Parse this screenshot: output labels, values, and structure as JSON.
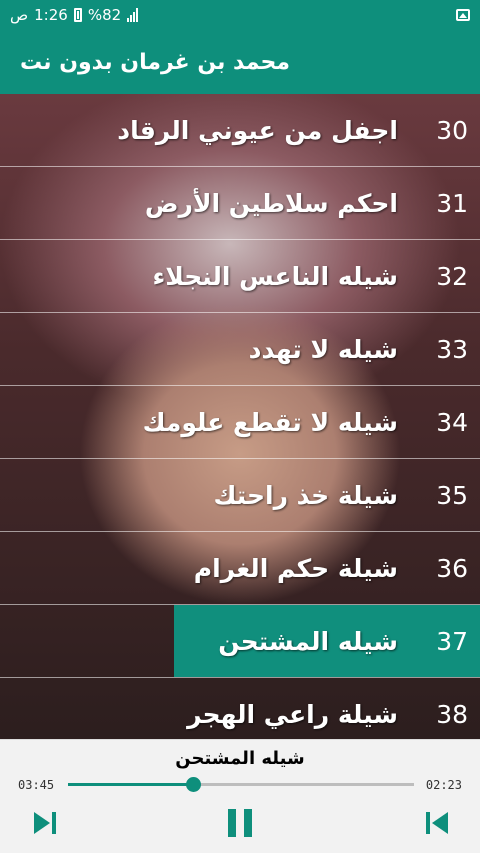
{
  "status": {
    "carrier": "ص",
    "time": "1:26",
    "battery": "%82"
  },
  "appbar": {
    "title": "محمد بن غرمان بدون نت"
  },
  "list": [
    {
      "num": "30",
      "title": "اجفل من عيوني الرقاد"
    },
    {
      "num": "31",
      "title": "احكم سلاطين الأرض"
    },
    {
      "num": "32",
      "title": "شيله الناعس النجلاء"
    },
    {
      "num": "33",
      "title": "شيله لا تهدد"
    },
    {
      "num": "34",
      "title": "شيله لا تقطع علومك"
    },
    {
      "num": "35",
      "title": "شيلة خذ راحتك"
    },
    {
      "num": "36",
      "title": "شيلة حكم الغرام"
    },
    {
      "num": "37",
      "title": "شيله المشتحن",
      "active": true
    },
    {
      "num": "38",
      "title": "شيلة راعي الهجر"
    }
  ],
  "player": {
    "now_playing": "شيله المشتحن",
    "elapsed": "03:45",
    "remaining": "02:23",
    "progress": 0.36
  },
  "colors": {
    "accent": "#0e8f7c"
  },
  "icons": {
    "status": [
      "gallery-icon",
      "battery-icon",
      "signal-icon"
    ],
    "controls": [
      "skip-next-icon",
      "pause-icon",
      "skip-previous-icon"
    ]
  }
}
